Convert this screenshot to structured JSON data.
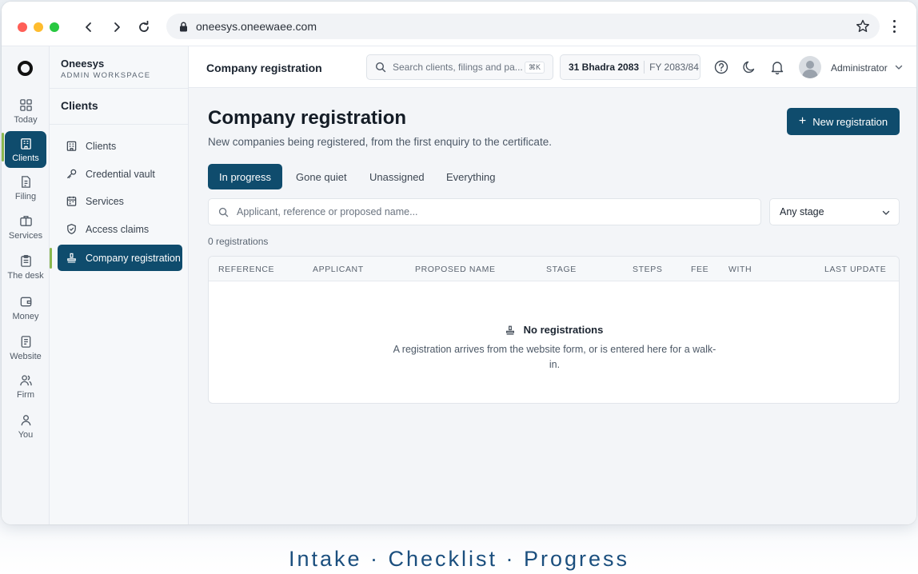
{
  "browser": {
    "url": "oneesys.oneewaee.com"
  },
  "brand": {
    "name": "Oneesys",
    "subtitle": "ADMIN WORKSPACE"
  },
  "rail": [
    {
      "label": "Today",
      "icon": "grid-icon"
    },
    {
      "label": "Clients",
      "icon": "building-icon",
      "active": true
    },
    {
      "label": "Filing",
      "icon": "document-icon"
    },
    {
      "label": "Services",
      "icon": "briefcase-icon"
    },
    {
      "label": "The desk",
      "icon": "clipboard-icon"
    },
    {
      "label": "Money",
      "icon": "wallet-icon"
    },
    {
      "label": "Website",
      "icon": "page-icon"
    },
    {
      "label": "Firm",
      "icon": "users-icon"
    },
    {
      "label": "You",
      "icon": "user-icon"
    }
  ],
  "sidebar": {
    "title": "Clients",
    "items": [
      {
        "label": "Clients",
        "icon": "building-icon"
      },
      {
        "label": "Credential vault",
        "icon": "key-icon"
      },
      {
        "label": "Services",
        "icon": "calendar-icon"
      },
      {
        "label": "Access claims",
        "icon": "shield-icon"
      },
      {
        "label": "Company registration",
        "icon": "stamp-icon",
        "active": true
      }
    ]
  },
  "topbar": {
    "title": "Company registration",
    "search_placeholder": "Search clients, filings and pa...",
    "search_shortcut": "⌘K",
    "date": "31 Bhadra 2083",
    "fiscal_year": "FY 2083/84",
    "user": "Administrator"
  },
  "main": {
    "title": "Company registration",
    "subtitle": "New companies being registered, from the first enquiry to the certificate.",
    "new_button": "New registration",
    "tabs": [
      "In progress",
      "Gone quiet",
      "Unassigned",
      "Everything"
    ],
    "active_tab": "In progress",
    "filter_placeholder": "Applicant, reference or proposed name...",
    "stage_select": "Any stage",
    "count": "0 registrations",
    "columns": [
      "REFERENCE",
      "APPLICANT",
      "PROPOSED NAME",
      "STAGE",
      "STEPS",
      "FEE",
      "WITH",
      "LAST UPDATE"
    ],
    "empty_title": "No registrations",
    "empty_desc": "A registration arrives from the website form, or is entered here for a walk-in."
  },
  "tagline": "Intake · Checklist · Progress",
  "colors": {
    "primary": "#0f4c6d",
    "accent": "#8bb84f"
  }
}
